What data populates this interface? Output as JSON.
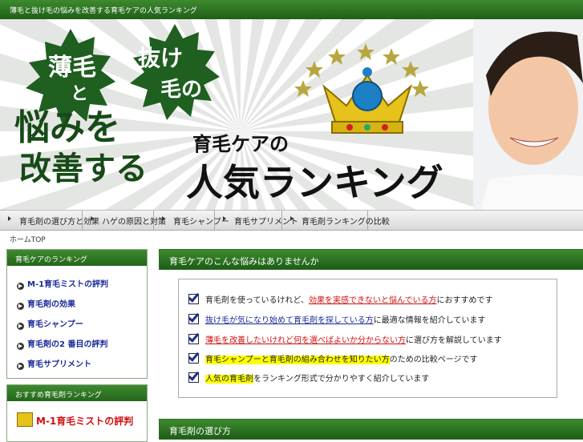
{
  "header": {
    "tagline": "薄毛と抜け毛の悩みを改善する育毛ケアの人気ランキング"
  },
  "banner": {
    "bubble1_line1": "薄毛",
    "bubble1_line2": "と",
    "bubble2_line1": "抜け",
    "bubble2_line2": "毛の",
    "headline_line1": "悩みを",
    "headline_line2": "改善する",
    "sub": "育毛ケアの",
    "big": "人気ランキング"
  },
  "nav": {
    "items": [
      {
        "label": "育毛剤の選び方と効果"
      },
      {
        "label": "ハゲの原因と対策"
      },
      {
        "label": "育毛シャンプー"
      },
      {
        "label": "育毛サプリメント"
      },
      {
        "label": "育毛剤ランキングの比較"
      }
    ]
  },
  "breadcrumb": "ホームTOP",
  "sidebar": {
    "box1_title": "育毛ケアのランキング",
    "box1_items": [
      {
        "label": "M-1育毛ミストの評判"
      },
      {
        "label": "育毛剤の効果"
      },
      {
        "label": "育毛シャンプー"
      },
      {
        "label": "育毛剤の2 番目の評判"
      },
      {
        "label": "育毛サプリメント"
      }
    ],
    "box2_title": "おすすめ育毛剤ランキング",
    "box2_item": "M-1育毛ミストの評判"
  },
  "main": {
    "section1_title": "育毛ケアのこんな悩みはありませんか",
    "checklist": [
      {
        "pre": "育毛剤を使っているけれど、",
        "link": "効果を実感できないと悩んでいる方",
        "post": "におすすめです",
        "style": "red"
      },
      {
        "pre": "",
        "link": "抜け毛が気になり始めて育毛剤を探している方",
        "post": "に最適な情報を紹介しています",
        "style": "blue"
      },
      {
        "pre": "",
        "link": "薄毛を改善したいけれど何を選べばよいか分からない方",
        "post": "に選び方を解説しています",
        "style": "red"
      },
      {
        "pre": "",
        "link": "育毛シャンプーと育毛剤の組み合わせを知りたい方",
        "post": "のための比較ページです",
        "style": "hl"
      },
      {
        "pre": "",
        "link": "人気の育毛剤",
        "post": "をランキング形式で分かりやすく紹介しています",
        "style": "hl"
      }
    ],
    "section2_title": "育毛剤の選び方"
  },
  "colors": {
    "brand_green": "#2a6f1f",
    "accent_red": "#d01010",
    "link_blue": "#1a2a9a",
    "highlight": "#ffff00"
  },
  "icons": [
    "crown-icon",
    "star-icon",
    "arrow-right-icon",
    "checkbox-checked-icon"
  ]
}
